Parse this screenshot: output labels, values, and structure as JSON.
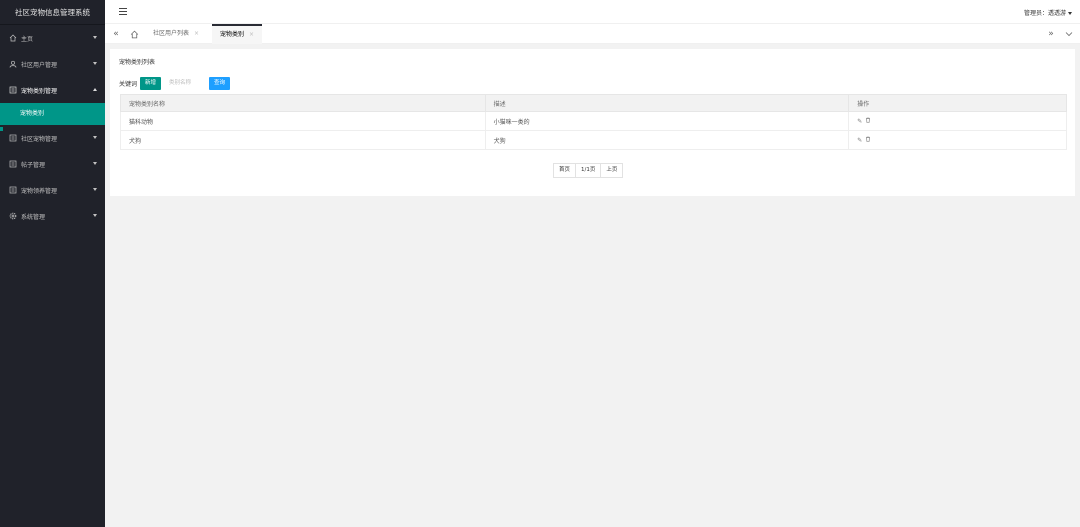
{
  "app": {
    "title": "社区宠物信息管理系统"
  },
  "sidebar": {
    "items": [
      {
        "label": "主页",
        "icon": "home-icon"
      },
      {
        "label": "社区用户管理",
        "icon": "user-icon"
      },
      {
        "label": "宠物类别管理",
        "icon": "list-icon",
        "open": true
      },
      {
        "label": "社区宠物管理",
        "icon": "list-icon"
      },
      {
        "label": "帖子管理",
        "icon": "list-icon"
      },
      {
        "label": "宠物领养管理",
        "icon": "list-icon"
      },
      {
        "label": "系统管理",
        "icon": "gear-icon"
      }
    ],
    "active_sub": "宠物类别"
  },
  "header": {
    "admin_label": "管理员：",
    "admin_name": "透透游"
  },
  "tabs": [
    {
      "label": "社区用户列表",
      "close": "×"
    },
    {
      "label": "宠物类别",
      "close": "×",
      "active": true
    }
  ],
  "content": {
    "title": "宠物类别列表",
    "keyword_label": "关键词",
    "add_button": "新增",
    "search_placeholder": "类别名称",
    "query_button": "查询",
    "table": {
      "headers": [
        "宠物类别名称",
        "描述",
        "操作"
      ],
      "rows": [
        {
          "name": "猫科动物",
          "desc": "小猫咪一类的"
        },
        {
          "name": "犬狗",
          "desc": "犬狗"
        }
      ]
    },
    "pager": {
      "first": "首页",
      "page": "1/1页",
      "prev": "上页"
    }
  },
  "colors": {
    "sidebar_bg": "#20222a",
    "accent_green": "#009688",
    "accent_blue": "#1e9fff"
  }
}
